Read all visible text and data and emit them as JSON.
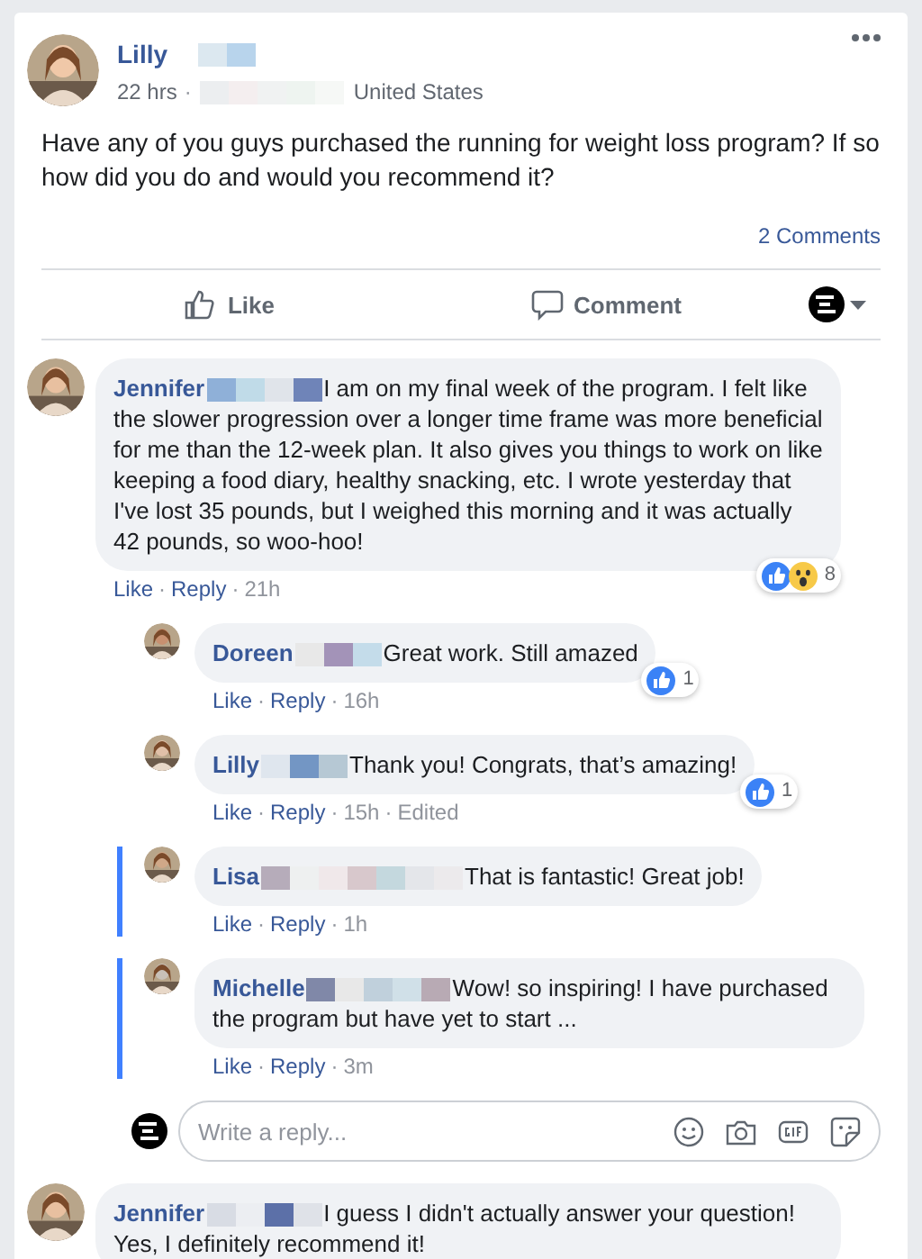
{
  "post": {
    "author": "Lilly",
    "time": "22 hrs",
    "separator": "·",
    "location": "United States",
    "text": "Have any of you guys purchased the running for weight loss program? If so how did you do and would you recommend it?",
    "comments_count": "2 Comments",
    "actions": [
      {
        "label": "Like",
        "kind": "like"
      },
      {
        "label": "Comment",
        "kind": "comment"
      }
    ]
  },
  "comments": [
    {
      "author": "Jennifer",
      "text": "I am on my final week of the program. I felt like the slower progression over a longer time frame was more beneficial for me than the 12-week plan. It also gives you things to work on like keeping a food diary, healthy snacking, etc. I wrote yesterday that I've lost 35 pounds, but I weighed this morning and it was actually 42 pounds, so woo-hoo!",
      "reactions": {
        "icons": [
          {
            "kind": "like"
          },
          {
            "kind": "wow"
          }
        ],
        "count": "8"
      },
      "meta": [
        {
          "text": "Like",
          "kind": "link"
        },
        {
          "text": "·",
          "kind": "dot"
        },
        {
          "text": "Reply",
          "kind": "link"
        },
        {
          "text": "·",
          "kind": "dot"
        },
        {
          "text": "21h",
          "kind": "time"
        }
      ],
      "replies": [
        {
          "author": "Doreen",
          "text": "Great work. Still amazed",
          "highlighted": false,
          "reactions": {
            "icons": [
              {
                "kind": "like"
              }
            ],
            "count": "1"
          },
          "meta": [
            {
              "text": "Like",
              "kind": "link"
            },
            {
              "text": "·",
              "kind": "dot"
            },
            {
              "text": "Reply",
              "kind": "link"
            },
            {
              "text": "·",
              "kind": "dot"
            },
            {
              "text": "16h",
              "kind": "time"
            }
          ]
        },
        {
          "author": "Lilly",
          "text": "Thank you! Congrats, that’s amazing!",
          "highlighted": false,
          "reactions": {
            "icons": [
              {
                "kind": "like"
              }
            ],
            "count": "1"
          },
          "meta": [
            {
              "text": "Like",
              "kind": "link"
            },
            {
              "text": "·",
              "kind": "dot"
            },
            {
              "text": "Reply",
              "kind": "link"
            },
            {
              "text": "·",
              "kind": "dot"
            },
            {
              "text": "15h",
              "kind": "time"
            },
            {
              "text": "·",
              "kind": "dot"
            },
            {
              "text": "Edited",
              "kind": "status"
            }
          ]
        },
        {
          "author": "Lisa",
          "text": "That is fantastic! Great job!",
          "highlighted": true,
          "meta": [
            {
              "text": "Like",
              "kind": "link"
            },
            {
              "text": "·",
              "kind": "dot"
            },
            {
              "text": "Reply",
              "kind": "link"
            },
            {
              "text": "·",
              "kind": "dot"
            },
            {
              "text": "1h",
              "kind": "time"
            }
          ]
        },
        {
          "author": "Michelle",
          "text": "Wow! so inspiring! I have purchased the program but have yet to start ...",
          "highlighted": true,
          "meta": [
            {
              "text": "Like",
              "kind": "link"
            },
            {
              "text": "·",
              "kind": "dot"
            },
            {
              "text": "Reply",
              "kind": "link"
            },
            {
              "text": "·",
              "kind": "dot"
            },
            {
              "text": "3m",
              "kind": "time"
            }
          ]
        }
      ],
      "reply_box": {
        "placeholder": "Write a reply..."
      }
    },
    {
      "author": "Jennifer",
      "text": "I guess I didn't actually answer your question! Yes, I definitely recommend it!"
    }
  ]
}
